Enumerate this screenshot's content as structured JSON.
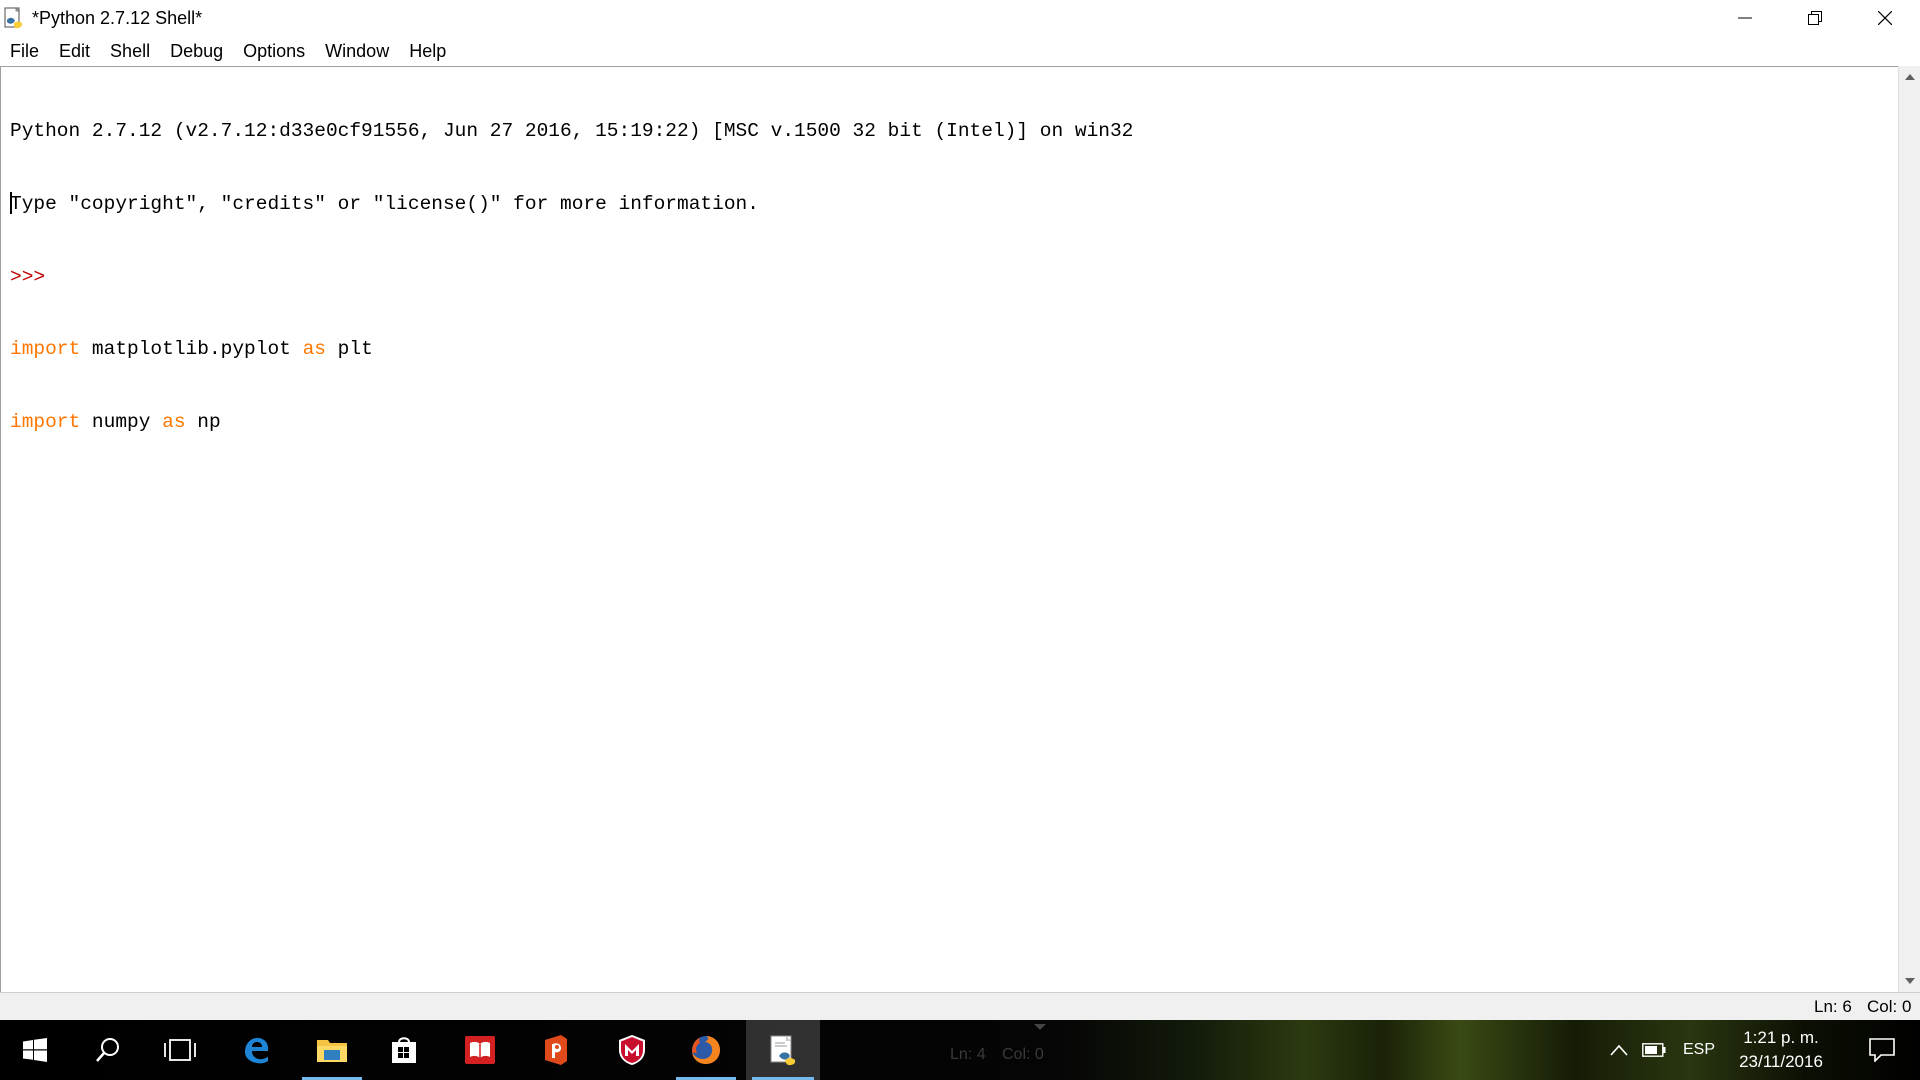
{
  "window": {
    "title": "*Python 2.7.12 Shell*",
    "icon": "python-idle-icon",
    "controls": [
      "minimize-icon",
      "restore-icon",
      "close-icon"
    ]
  },
  "menu": {
    "items": [
      "File",
      "Edit",
      "Shell",
      "Debug",
      "Options",
      "Window",
      "Help"
    ]
  },
  "editor": {
    "banner_line1": "Python 2.7.12 (v2.7.12:d33e0cf91556, Jun 27 2016, 15:19:22) [MSC v.1500 32 bit (Intel)] on win32",
    "banner_line2": "Type \"copyright\", \"credits\" or \"license()\" for more information.",
    "prompt": ">>>",
    "code": [
      {
        "keyword": "import",
        "module": " matplotlib.pyplot ",
        "as_kw": "as",
        "alias": " plt"
      },
      {
        "keyword": "import",
        "module": " numpy ",
        "as_kw": "as",
        "alias": " np"
      }
    ],
    "colors": {
      "keyword": "#ff7700",
      "prompt": "#c00000",
      "text": "#000000"
    }
  },
  "status": {
    "line": "Ln: 6",
    "col": "Col: 0"
  },
  "taskbar": {
    "apps": [
      "windows-start-icon",
      "search-icon",
      "task-view-icon",
      "edge-icon",
      "file-explorer-icon",
      "store-icon",
      "reader-icon",
      "office-icon",
      "mcafee-icon",
      "firefox-icon",
      "python-idle-icon"
    ],
    "background_status_line": "Ln: 4",
    "background_status_col": "Col: 0",
    "language": "ESP",
    "time": "1:21 p. m.",
    "date": "23/11/2016",
    "colors": {
      "active_underline": "#76b9ed"
    }
  }
}
